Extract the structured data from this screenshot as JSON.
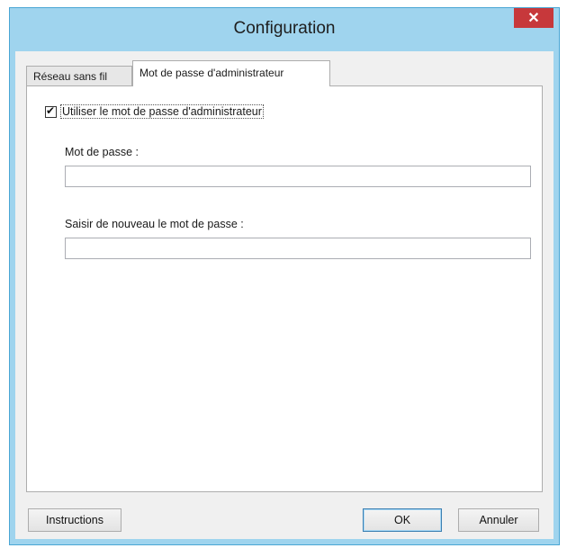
{
  "window": {
    "title": "Configuration",
    "close_glyph": "✕"
  },
  "tabs": [
    {
      "label": "Réseau sans fil",
      "active": false
    },
    {
      "label": "Mot de passe d'administrateur",
      "active": true
    }
  ],
  "panel": {
    "use_admin_password": {
      "label": "Utiliser le mot de passe d'administrateur",
      "checked": true
    },
    "password": {
      "label": "Mot de passe :",
      "value": ""
    },
    "confirm_password": {
      "label": "Saisir de nouveau le mot de passe :",
      "value": ""
    }
  },
  "buttons": {
    "instructions": "Instructions",
    "ok": "OK",
    "cancel": "Annuler"
  },
  "colors": {
    "title_bar": "#9fd4ee",
    "close_button": "#c7383b",
    "client_bg": "#f0f0f0"
  }
}
